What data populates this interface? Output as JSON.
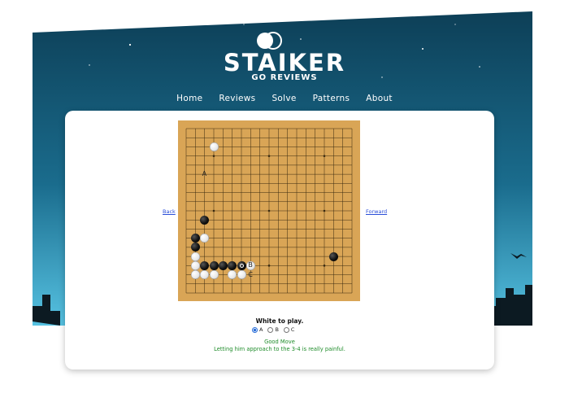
{
  "site": {
    "brand": "STAIKER",
    "tagline": "GO REVIEWS"
  },
  "nav": [
    "Home",
    "Reviews",
    "Solve",
    "Patterns",
    "About"
  ],
  "problem": {
    "back_label": "Back",
    "forward_label": "Forward",
    "prompt": "White to play.",
    "options": [
      {
        "label": "A",
        "selected": true
      },
      {
        "label": "B",
        "selected": false
      },
      {
        "label": "C",
        "selected": false
      }
    ],
    "result_title": "Good Move",
    "result_text": "Letting him approach to the 3-4 is really painful."
  },
  "board": {
    "size": 19,
    "stones": {
      "black": [
        [
          2,
          10
        ],
        [
          1,
          12
        ],
        [
          1,
          13
        ],
        [
          2,
          15
        ],
        [
          3,
          15
        ],
        [
          4,
          15
        ],
        [
          5,
          15
        ],
        [
          6,
          15
        ],
        [
          16,
          14
        ]
      ],
      "white": [
        [
          3,
          2
        ],
        [
          2,
          12
        ],
        [
          1,
          14
        ],
        [
          1,
          15
        ],
        [
          1,
          16
        ],
        [
          2,
          16
        ],
        [
          3,
          16
        ],
        [
          5,
          16
        ],
        [
          6,
          16
        ],
        [
          7,
          15
        ]
      ],
      "marked": [
        [
          6,
          15
        ]
      ]
    },
    "labels": [
      {
        "text": "A",
        "point": [
          2,
          5
        ]
      },
      {
        "text": "B",
        "point": [
          7,
          15
        ]
      },
      {
        "text": "C",
        "point": [
          7,
          16
        ]
      }
    ]
  },
  "colors": {
    "sky_top": "#0f4a63",
    "sky_bottom": "#4fb6d8",
    "board_wood": "#d9a556",
    "good_move": "#1e8c2a",
    "link": "#2a4ed8"
  }
}
